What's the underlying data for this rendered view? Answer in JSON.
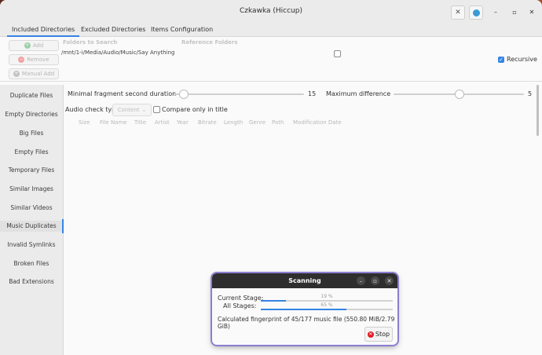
{
  "window": {
    "title": "Czkawka (Hiccup)"
  },
  "top_tabs": [
    {
      "label": "Included Directories"
    },
    {
      "label": "Excluded Directories"
    },
    {
      "label": "Items Configuration"
    }
  ],
  "dir_panel": {
    "buttons": {
      "add": "Add",
      "remove": "Remove",
      "manual_add": "Manual Add"
    },
    "header_folders": "Folders to Search",
    "header_reference": "Reference Folders",
    "folders": [
      {
        "path": "/mnt/1-i/Media/Audio/Music/Say Anything",
        "reference": false
      }
    ],
    "recursive_label": "Recursive",
    "recursive_checked": true
  },
  "sidebar": {
    "items": [
      {
        "label": "Duplicate Files"
      },
      {
        "label": "Empty Directories"
      },
      {
        "label": "Big Files"
      },
      {
        "label": "Empty Files"
      },
      {
        "label": "Temporary Files"
      },
      {
        "label": "Similar Images"
      },
      {
        "label": "Similar Videos"
      },
      {
        "label": "Music Duplicates"
      },
      {
        "label": "Invalid Symlinks"
      },
      {
        "label": "Broken Files"
      },
      {
        "label": "Bad Extensions"
      }
    ],
    "active_index": 7
  },
  "music": {
    "min_fragment_label": "Minimal fragment second duration",
    "min_fragment_value": "15",
    "min_fragment_level": 0.07,
    "max_difference_label": "Maximum difference",
    "max_difference_value": "5",
    "max_difference_level": 0.5,
    "audio_check_label": "Audio check type",
    "audio_check_value": "Content",
    "compare_title_label": "Compare only in title",
    "columns": [
      "Size",
      "File Name",
      "Title",
      "Artist",
      "Year",
      "Bitrate",
      "Length",
      "Genre",
      "Path",
      "Modification Date"
    ]
  },
  "dialog": {
    "title": "Scanning",
    "current_stage_label": "Current Stage:",
    "current_stage_text": "19 %",
    "current_stage_value": 0.19,
    "all_stages_label": "All Stages:",
    "all_stages_text": "65 %",
    "all_stages_value": 0.65,
    "status": "Calculated fingerprint of 45/177 music file (550.80 MiB/2.79 GiB)",
    "stop_label": "Stop"
  },
  "colors": {
    "accent": "#3584e4",
    "stop_icon": "#e01b24",
    "add_icon": "#33a853",
    "remove_icon": "#e01b24"
  }
}
